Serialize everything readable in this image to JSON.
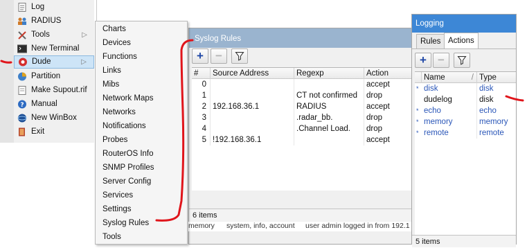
{
  "main_menu": {
    "items": [
      {
        "label": "Log",
        "icon": "log-icon",
        "name": "menu-item-log"
      },
      {
        "label": "RADIUS",
        "icon": "radius-icon",
        "name": "menu-item-radius"
      },
      {
        "label": "Tools",
        "icon": "tools-icon",
        "name": "menu-item-tools",
        "submenu": true
      },
      {
        "label": "New Terminal",
        "icon": "terminal-icon",
        "name": "menu-item-new-terminal"
      },
      {
        "label": "Dude",
        "icon": "dude-icon",
        "name": "menu-item-dude",
        "submenu": true,
        "selected": true
      },
      {
        "label": "Partition",
        "icon": "partition-icon",
        "name": "menu-item-partition"
      },
      {
        "label": "Make Supout.rif",
        "icon": "document-icon",
        "name": "menu-item-make-supout"
      },
      {
        "label": "Manual",
        "icon": "help-icon",
        "name": "menu-item-manual"
      },
      {
        "label": "New WinBox",
        "icon": "winbox-icon",
        "name": "menu-item-new-winbox"
      },
      {
        "label": "Exit",
        "icon": "exit-icon",
        "name": "menu-item-exit"
      }
    ],
    "arrow": "▷"
  },
  "dude_submenu": {
    "items": [
      "Charts",
      "Devices",
      "Functions",
      "Links",
      "Mibs",
      "Network Maps",
      "Networks",
      "Notifications",
      "Probes",
      "RouterOS Info",
      "SNMP Profiles",
      "Server Config",
      "Services",
      "Settings",
      "Syslog Rules",
      "Tools"
    ]
  },
  "syslog_window": {
    "title": "Syslog Rules",
    "columns": [
      "#",
      "Source Address",
      "Regexp",
      "Action"
    ],
    "rows": [
      {
        "num": "0",
        "source": "",
        "regexp": "",
        "action": "accept"
      },
      {
        "num": "1",
        "source": "",
        "regexp": "CT not confirmed",
        "action": "drop"
      },
      {
        "num": "2",
        "source": "192.168.36.1",
        "regexp": "RADIUS",
        "action": "accept"
      },
      {
        "num": "3",
        "source": "",
        "regexp": ".radar_bb.",
        "action": "drop"
      },
      {
        "num": "4",
        "source": "",
        "regexp": ".Channel Load.",
        "action": "drop"
      },
      {
        "num": "5",
        "source": "!192.168.36.1",
        "regexp": "",
        "action": "accept"
      }
    ],
    "status": "6 items"
  },
  "background_log": {
    "col1": "memory",
    "col2": "system, info, account",
    "col3": "user admin logged in from 192.1"
  },
  "logging_window": {
    "title": "Logging",
    "tabs": [
      "Rules",
      "Actions"
    ],
    "active_tab": "Actions",
    "columns": [
      "Name",
      "Type"
    ],
    "sort_indicator": "/",
    "rows": [
      {
        "name": "disk",
        "type": "disk",
        "default": true
      },
      {
        "name": "dudelog",
        "type": "disk",
        "default": false
      },
      {
        "name": "echo",
        "type": "echo",
        "default": true
      },
      {
        "name": "memory",
        "type": "memory",
        "default": true
      },
      {
        "name": "remote",
        "type": "remote",
        "default": true
      }
    ],
    "default_marker": "*",
    "status": "5 items"
  },
  "colors": {
    "syslog_title_bg": "#9ab4cf",
    "logging_title_bg": "#3d87d6",
    "annotation_red": "#e0151b",
    "link_blue": "#2a56b8"
  }
}
